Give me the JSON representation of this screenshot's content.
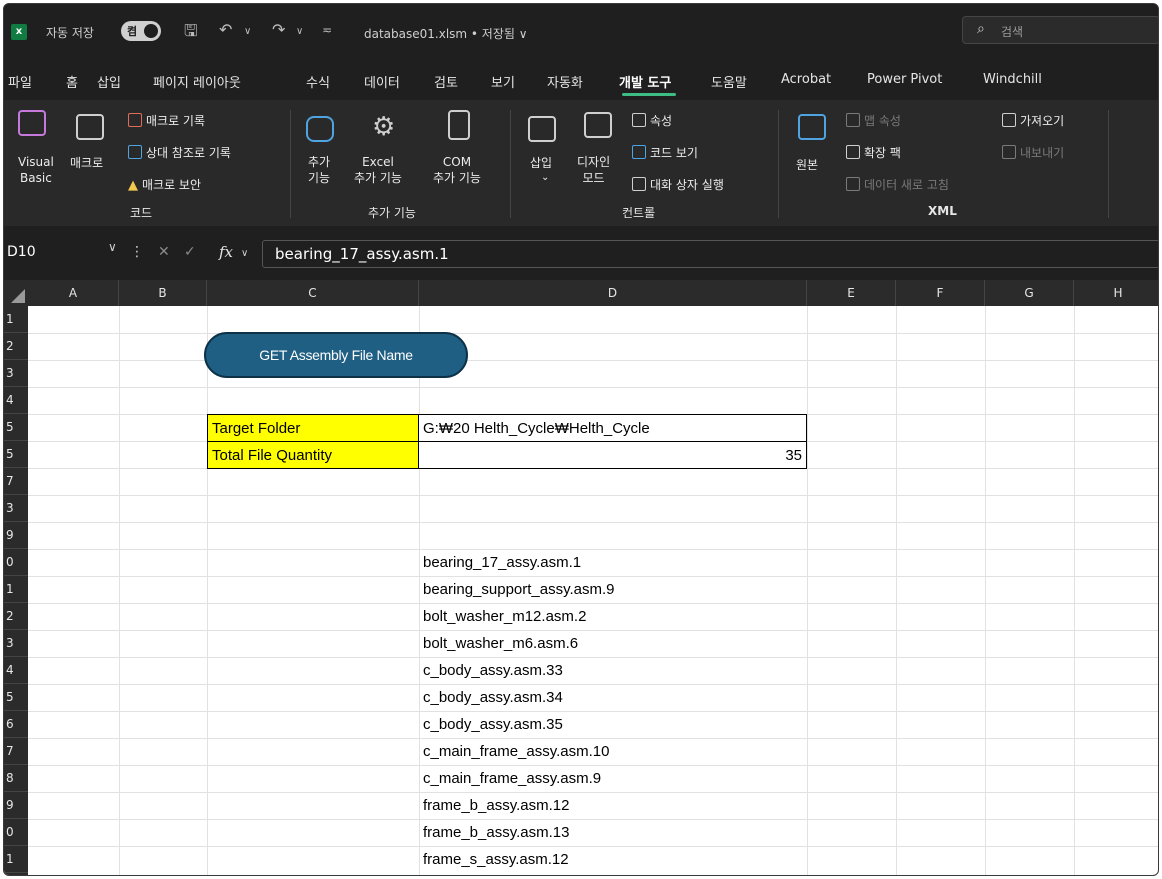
{
  "titlebar": {
    "autosave_label": "자동 저장",
    "autosave_toggle": "켬",
    "filename": "database01.xlsm • 저장됨 ∨",
    "search_placeholder": "검색"
  },
  "tabs": [
    "파일",
    "홈",
    "삽입",
    "페이지 레이아웃",
    "수식",
    "데이터",
    "검토",
    "보기",
    "자동화",
    "개발 도구",
    "도움말",
    "Acrobat",
    "Power Pivot",
    "Windchill"
  ],
  "active_tab": "개발 도구",
  "ribbon": {
    "code": {
      "visual_basic": "Visual\nBasic",
      "macro": "매크로",
      "record_macro": "매크로 기록",
      "relative_ref": "상대 참조로 기록",
      "macro_security": "매크로 보안",
      "group": "코드"
    },
    "addins": {
      "addins": "추가\n기능",
      "excel_addins": "Excel\n추가 기능",
      "com_addins": "COM\n추가 기능",
      "group": "추가 기능"
    },
    "controls": {
      "insert": "삽입",
      "design_mode": "디자인\n모드",
      "properties": "속성",
      "view_code": "코드 보기",
      "run_dialog": "대화 상자 실행",
      "group": "컨트롤"
    },
    "xml": {
      "source": "원본",
      "map_properties": "맵 속성",
      "expansion_packs": "확장 팩",
      "refresh_data": "데이터 새로 고침",
      "import": "가져오기",
      "export": "내보내기",
      "group": "XML"
    }
  },
  "formula_bar": {
    "name_box": "D10",
    "formula": "bearing_17_assy.asm.1"
  },
  "columns": [
    "A",
    "B",
    "C",
    "D",
    "E",
    "F",
    "G",
    "H"
  ],
  "row_headers": [
    "1",
    "2",
    "3",
    "4",
    "5",
    "5",
    "7",
    "3",
    "9",
    "0",
    "1",
    "2",
    "3",
    "4",
    "5",
    "6",
    "7",
    "8",
    "9",
    "0",
    "1"
  ],
  "sheet": {
    "button_label": "GET Assembly File Name",
    "target_folder_label": "Target Folder",
    "target_folder_value": "G:₩20 Helth_Cycle₩Helth_Cycle",
    "total_qty_label": "Total File Quantity",
    "total_qty_value": "35",
    "files": [
      "bearing_17_assy.asm.1",
      "bearing_support_assy.asm.9",
      "bolt_washer_m12.asm.2",
      "bolt_washer_m6.asm.6",
      "c_body_assy.asm.33",
      "c_body_assy.asm.34",
      "c_body_assy.asm.35",
      "c_main_frame_assy.asm.10",
      "c_main_frame_assy.asm.9",
      "frame_b_assy.asm.12",
      "frame_b_assy.asm.13",
      "frame_s_assy.asm.12"
    ]
  }
}
